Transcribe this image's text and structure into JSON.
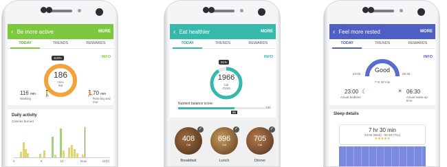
{
  "phones": [
    {
      "title": "Be more active",
      "more": "MORE",
      "back": "‹",
      "tabs": [
        "TODAY",
        "TRENDS",
        "REWARDS"
      ],
      "info": "INFO",
      "ring": {
        "badge": "310%",
        "value": "186",
        "unit": "mins",
        "sub": "/60",
        "progress": 1.0,
        "color": "#f3a33a"
      },
      "walking": {
        "value": "116",
        "unit": "min",
        "label": "Walking"
      },
      "running": {
        "value": "70",
        "unit": "min",
        "label": "Running and mor"
      },
      "section_title": "Daily activity",
      "section_sub": "Calories burned",
      "xaxis": [
        "0",
        "6",
        "12",
        "Now",
        "24(h)"
      ]
    },
    {
      "title": "Eat healthier",
      "more": "MORE",
      "back": "‹",
      "tabs": [
        "TODAY",
        "TRENDS",
        "REWARDS"
      ],
      "info": "INFO",
      "ring": {
        "badge": "91%",
        "value": "1966",
        "unit": "Cal",
        "sub": "/2150",
        "progress": 0.91,
        "color": "#35b9ab"
      },
      "nutrient_label": "Nutrient balance score",
      "nutrient_value": "65",
      "nutrient_max": "100",
      "nutrient_progress": 0.65,
      "meals": [
        {
          "value": "408",
          "unit": "Cal",
          "label": "Breakfast"
        },
        {
          "value": "696",
          "unit": "Cal",
          "label": "Lunch"
        },
        {
          "value": "705",
          "unit": "Cal",
          "label": "Dinner"
        }
      ]
    },
    {
      "title": "Feel more rested",
      "more": "MORE",
      "back": "‹",
      "tabs": [
        "TODAY",
        "TRENDS",
        "REWARDS"
      ],
      "info": "INFO",
      "gauge": {
        "label": "Good",
        "left": "23:00",
        "right": "06:30",
        "duration": "7 hr 30 min"
      },
      "bedtime": {
        "value": "23:00",
        "label": "Actual bedtime"
      },
      "wakeup": {
        "value": "06:30",
        "label": "Actual wake-up time"
      },
      "section_title": "Sleep details",
      "detail_duration": "7 hr 30 min",
      "detail_range": "23:00 (Wed) - 06:30 (Thu)",
      "stars": "★★★★★"
    }
  ]
}
